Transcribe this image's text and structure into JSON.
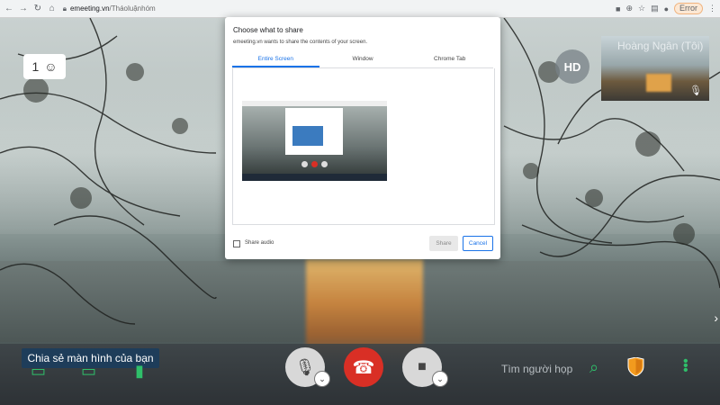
{
  "browser": {
    "url_domain": "emeeting.vn",
    "url_path": "/Tháoluậnhóm",
    "error_label": "Error"
  },
  "meeting": {
    "participant_count": "1",
    "remote_avatar": "HD",
    "self_name": "Hoàng Ngân (Tôi)",
    "tooltip": "Chia sẻ màn hình của bạn",
    "search_placeholder": "Tìm người họp"
  },
  "share_dialog": {
    "title": "Choose what to share",
    "description": "emeeting.vn wants to share the contents of your screen.",
    "tabs": [
      "Entire Screen",
      "Window",
      "Chrome Tab"
    ],
    "audio_label": "Share audio",
    "share_label": "Share",
    "cancel_label": "Cancel"
  },
  "colors": {
    "hangup": "#d92f25",
    "accent": "#1a73e8",
    "green": "#2fbf6a",
    "tooltip_bg": "#1e3d5a"
  },
  "icons": [
    "back-icon",
    "forward-icon",
    "reload-icon",
    "home-icon",
    "lock-icon",
    "camera-icon",
    "zoom-icon",
    "star-icon",
    "extensions-icon",
    "profile-icon",
    "participants-icon",
    "mic-off-icon",
    "hangup-icon",
    "video-icon",
    "chevron-down-icon",
    "search-icon",
    "shield-icon",
    "more-icon"
  ]
}
